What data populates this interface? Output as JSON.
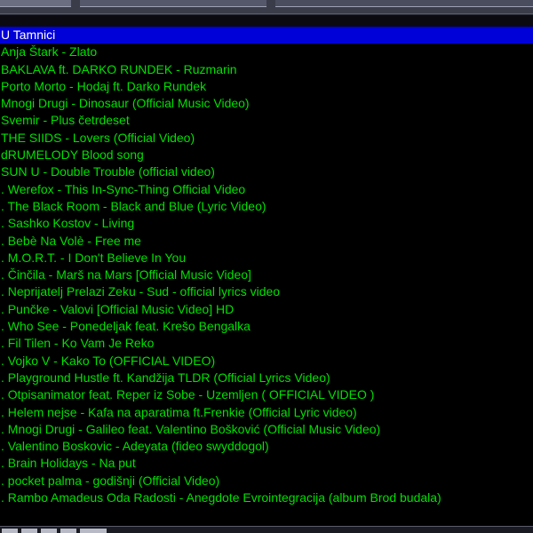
{
  "colors": {
    "background": "#000000",
    "text": "#00e000",
    "selected_background": "#0000d8",
    "selected_text": "#ffffff"
  },
  "playlist": {
    "selected_index": 0,
    "items": [
      "U Tamnici",
      "Anja Štark - Zlato",
      "BAKLAVA ft. DARKO RUNDEK - Ruzmarin",
      "Porto Morto - Hodaj ft. Darko Rundek",
      "Mnogi Drugi - Dinosaur (Official Music Video)",
      "Svemir - Plus četrdeset",
      "THE SIIDS - Lovers (Official Video)",
      "dRUMELODY Blood song",
      "SUN U - Double Trouble (official video)",
      ". Werefox - This In-Sync-Thing Official Video",
      ". The Black Room - Black and Blue (Lyric Video)",
      ". Sashko Kostov - Living",
      ". Bebè Na Volè - Free me",
      ". M.O.R.T. - I Don't Believe In You",
      ". Činčila - Marš na Mars [Official Music Video]",
      ". Neprijatelj Prelazi Zeku - Sud - official lyrics video",
      ". Punčke - Valovi [Official Music Video] HD",
      ". Who See - Ponedeljak feat. Krešo Bengalka",
      ". Fil Tilen - Ko Vam Je Reko",
      ". Vojko V - Kako To (OFFICIAL VIDEO)",
      ". Playground Hustle ft. Kandžija TLDR (Official Lyrics Video)",
      ". Otpisanimator feat. Reper iz Sobe - Uzemljen ( OFFICIAL VIDEO )",
      ". Helem nejse - Kafa na aparatima ft.Frenkie (Official Lyric video)",
      ". Mnogi Drugi - Galileo feat. Valentino Bošković (Official Music Video)",
      ". Valentino Boskovic - Adeyata (fideo swyddogol)",
      ". Brain Holidays - Na put",
      ". pocket palma - godišnji (Official Video)",
      ". Rambo Amadeus Oda Radosti - Anegdote Evrointegracija (album Brod budala)"
    ]
  }
}
